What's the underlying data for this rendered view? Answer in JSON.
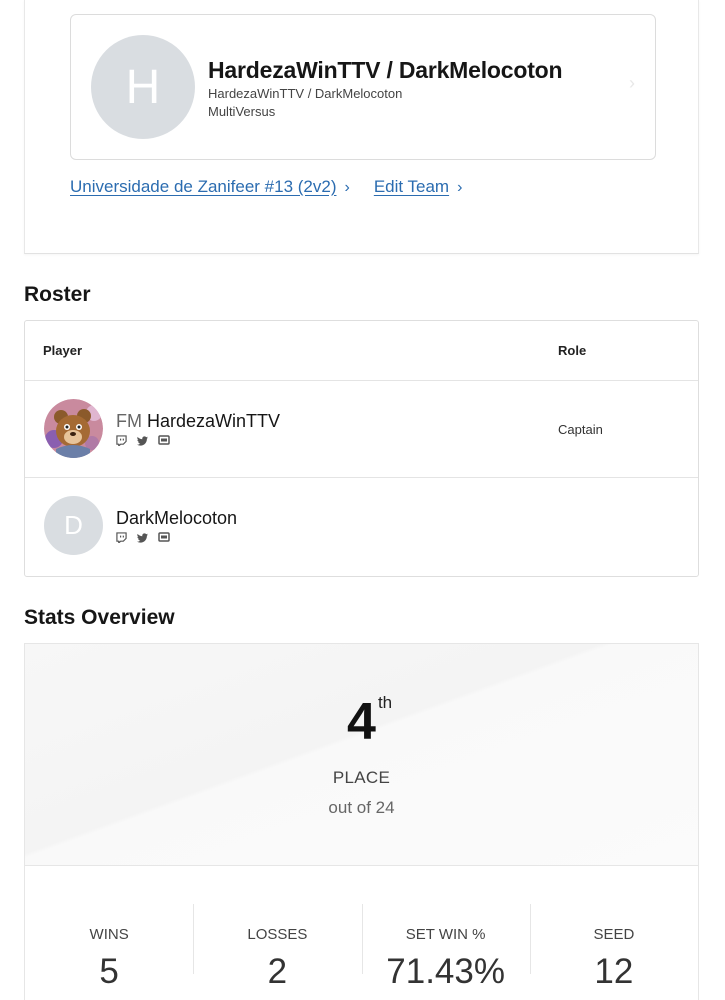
{
  "team_card": {
    "avatar_letter": "H",
    "name": "HardezaWinTTV / DarkMelocoton",
    "subtitle": "HardezaWinTTV / DarkMelocoton",
    "game": "MultiVersus"
  },
  "links": {
    "tournament": "Universidade de Zanifeer #13 (2v2)",
    "edit_team": "Edit Team"
  },
  "roster": {
    "title": "Roster",
    "col_player": "Player",
    "col_role": "Role",
    "players": [
      {
        "prefix": "FM",
        "name": "HardezaWinTTV",
        "role": "Captain",
        "avatar": "bear-character-avatar"
      },
      {
        "prefix": "",
        "name": "DarkMelocoton",
        "role": "",
        "avatar_letter": "D"
      }
    ],
    "social_icons": [
      "twitch-icon",
      "twitter-icon",
      "discord-icon"
    ]
  },
  "stats": {
    "title": "Stats Overview",
    "place": "4",
    "place_suffix": "th",
    "place_label": "PLACE",
    "out_of": "out of 24",
    "items": [
      {
        "label": "WINS",
        "value": "5"
      },
      {
        "label": "LOSSES",
        "value": "2"
      },
      {
        "label": "SET WIN %",
        "value": "71.43%"
      },
      {
        "label": "SEED",
        "value": "12"
      }
    ]
  },
  "colors": {
    "link": "#2b6cb0",
    "avatar_placeholder": "#d9dde1"
  }
}
